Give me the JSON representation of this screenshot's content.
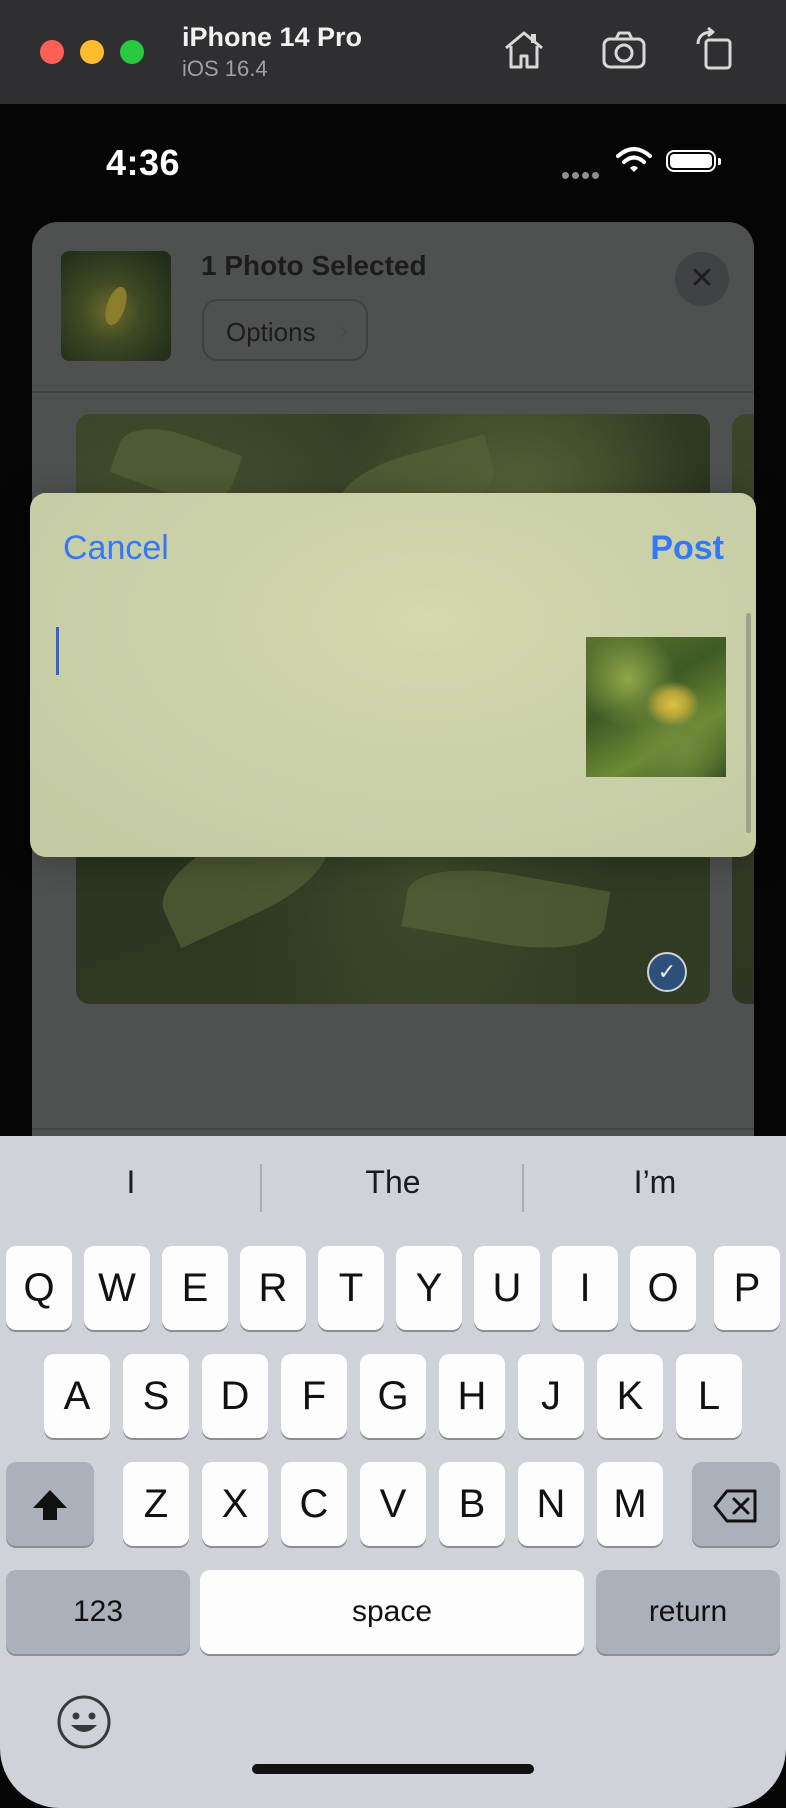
{
  "simulator": {
    "device_name": "iPhone 14 Pro",
    "os_version": "iOS 16.4",
    "toolbar_icons": [
      "home-icon",
      "screenshot-camera-icon",
      "rotate-icon"
    ]
  },
  "status_bar": {
    "time": "4:36",
    "icons": [
      "signal-dots-icon",
      "wifi-icon",
      "battery-icon"
    ]
  },
  "share_sheet": {
    "title": "1 Photo Selected",
    "options_label": "Options",
    "options_chevron": "›",
    "close_glyph": "✕",
    "selected_check": "✓",
    "apps": [
      "reminders-app-icon",
      "pointer-app-icon",
      "more-apps-icon"
    ],
    "more_glyph": "•••"
  },
  "composer": {
    "cancel_label": "Cancel",
    "post_label": "Post",
    "text_value": ""
  },
  "keyboard": {
    "suggestions": [
      "I",
      "The",
      "I’m"
    ],
    "row1": [
      "Q",
      "W",
      "E",
      "R",
      "T",
      "Y",
      "U",
      "I",
      "O",
      "P"
    ],
    "row2": [
      "A",
      "S",
      "D",
      "F",
      "G",
      "H",
      "J",
      "K",
      "L"
    ],
    "row3": [
      "Z",
      "X",
      "C",
      "V",
      "B",
      "N",
      "M"
    ],
    "numbers_label": "123",
    "space_label": "space",
    "return_label": "return",
    "accent_color": "#3478f6"
  }
}
